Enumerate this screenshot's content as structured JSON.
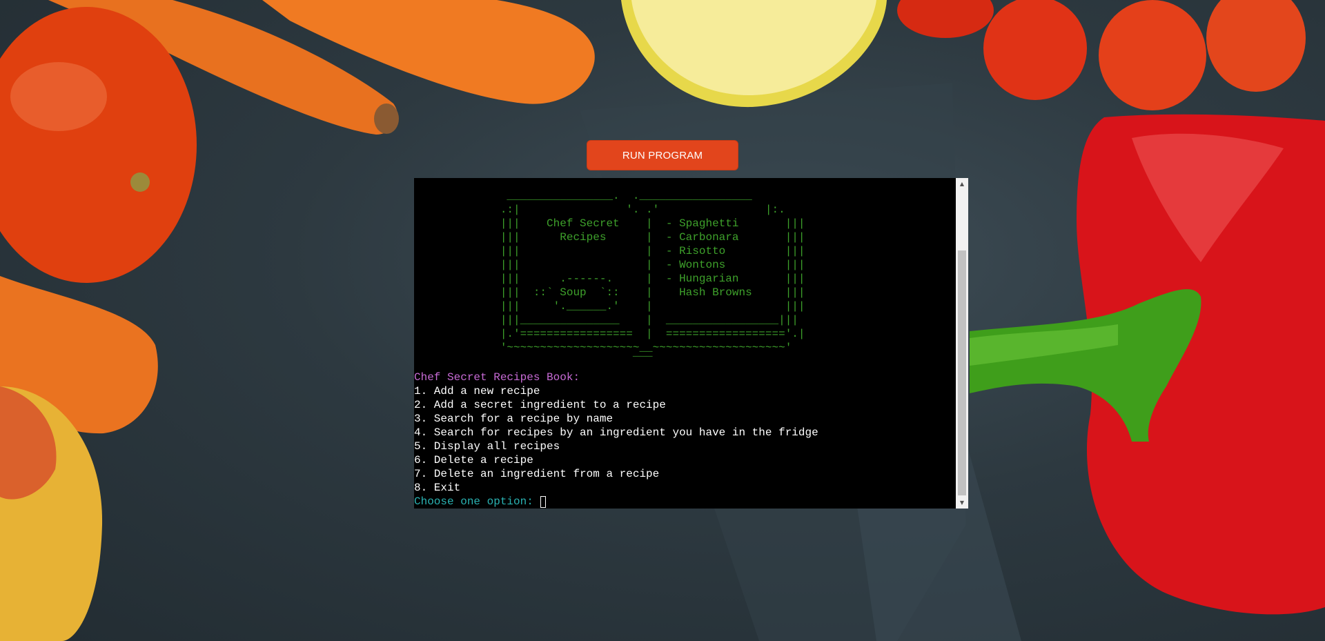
{
  "toolbar": {
    "run_label": "RUN PROGRAM"
  },
  "terminal": {
    "ascii_art": "              ________________.  ._________________\n             .:|                '. .'                |:.\n             |||    Chef Secret    |  - Spaghetti       |||\n             |||      Recipes      |  - Carbonara       |||\n             |||                   |  - Risotto         |||\n             |||                   |  - Wontons         |||\n             |||      .------.     |  - Hungarian       |||\n             |||  ::` Soup  `::    |    Hash Browns     |||\n             |||     '.______.'    |                    |||\n             |||_______________    |  _________________|||\n             |.'=================  |  =================='.|\n             '~~~~~~~~~~~~~~~~~~~~__~~~~~~~~~~~~~~~~~~~~'\n                                 ‾‾‾",
    "menu_title": "Chef Secret Recipes Book:",
    "menu_items": [
      "1. Add a new recipe",
      "2. Add a secret ingredient to a recipe",
      "3. Search for a recipe by name",
      "4. Search for recipes by an ingredient you have in the fridge",
      "5. Display all recipes",
      "6. Delete a recipe",
      "7. Delete an ingredient from a recipe",
      "8. Exit"
    ],
    "prompt": "Choose one option: "
  },
  "colors": {
    "button": "#e2451c",
    "terminal_bg": "#000000",
    "art_green": "#3ea12b",
    "title_purple": "#c86bd6",
    "prompt_cyan": "#2ab3b3"
  },
  "icons": {
    "scroll_up": "triangle-up-icon",
    "scroll_down": "triangle-down-icon"
  }
}
